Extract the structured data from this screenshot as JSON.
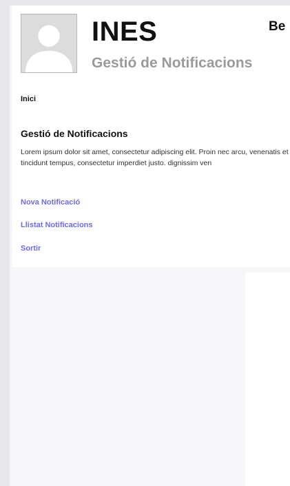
{
  "header": {
    "title": "INES",
    "subtitle": "Gestió de Notificacions",
    "welcome": "Be"
  },
  "breadcrumb": "Inici",
  "main": {
    "section_title": "Gestió de Notificacions",
    "description": "Lorem ipsum dolor sit amet, consectetur adipiscing elit. Proin nec arcu, venenatis et tincidunt tempus, consectetur imperdiet justo. dignissim ven"
  },
  "menu": {
    "new_notification": "Nova Notificació",
    "list_notifications": "Llistat Notificacions",
    "exit": "Sortir"
  },
  "icons": {
    "avatar": "user-avatar-icon"
  },
  "colors": {
    "link": "#6b6bf0",
    "subtitle": "#9a9a9a",
    "background": "#e8e8ec"
  }
}
